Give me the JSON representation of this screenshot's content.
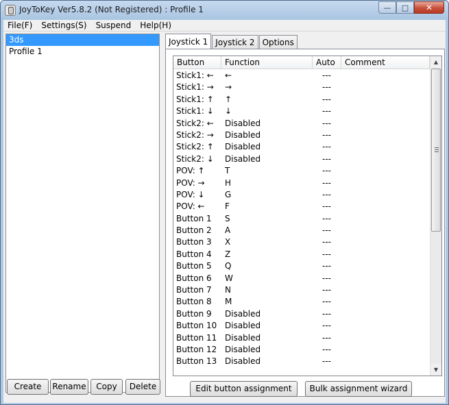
{
  "window": {
    "title": "JoyToKey Ver5.8.2 (Not Registered) : Profile 1",
    "buttons": {
      "minimize": "—",
      "maximize": "□",
      "close": "✕"
    }
  },
  "menu": [
    "File(F)",
    "Settings(S)",
    "Suspend",
    "Help(H)"
  ],
  "profiles": {
    "items": [
      {
        "label": "3ds",
        "selected": true
      },
      {
        "label": "Profile 1",
        "selected": false
      }
    ],
    "buttons": {
      "create": "Create",
      "rename": "Rename",
      "copy": "Copy",
      "delete": "Delete"
    }
  },
  "tabs": [
    {
      "label": "Joystick 1",
      "active": true
    },
    {
      "label": "Joystick 2",
      "active": false
    },
    {
      "label": "Options",
      "active": false
    }
  ],
  "table": {
    "columns": [
      "Button",
      "Function",
      "Auto",
      "Comment"
    ],
    "rows": [
      [
        "Stick1: ←",
        "←",
        "---",
        ""
      ],
      [
        "Stick1: →",
        "→",
        "---",
        ""
      ],
      [
        "Stick1: ↑",
        "↑",
        "---",
        ""
      ],
      [
        "Stick1: ↓",
        "↓",
        "---",
        ""
      ],
      [
        "Stick2: ←",
        "Disabled",
        "---",
        ""
      ],
      [
        "Stick2: →",
        "Disabled",
        "---",
        ""
      ],
      [
        "Stick2: ↑",
        "Disabled",
        "---",
        ""
      ],
      [
        "Stick2: ↓",
        "Disabled",
        "---",
        ""
      ],
      [
        "POV: ↑",
        "T",
        "---",
        ""
      ],
      [
        "POV: →",
        "H",
        "---",
        ""
      ],
      [
        "POV: ↓",
        "G",
        "---",
        ""
      ],
      [
        "POV: ←",
        "F",
        "---",
        ""
      ],
      [
        "Button 1",
        "S",
        "---",
        ""
      ],
      [
        "Button 2",
        "A",
        "---",
        ""
      ],
      [
        "Button 3",
        "X",
        "---",
        ""
      ],
      [
        "Button 4",
        "Z",
        "---",
        ""
      ],
      [
        "Button 5",
        "Q",
        "---",
        ""
      ],
      [
        "Button 6",
        "W",
        "---",
        ""
      ],
      [
        "Button 7",
        "N",
        "---",
        ""
      ],
      [
        "Button 8",
        "M",
        "---",
        ""
      ],
      [
        "Button 9",
        "Disabled",
        "---",
        ""
      ],
      [
        "Button 10",
        "Disabled",
        "---",
        ""
      ],
      [
        "Button 11",
        "Disabled",
        "---",
        ""
      ],
      [
        "Button 12",
        "Disabled",
        "---",
        ""
      ],
      [
        "Button 13",
        "Disabled",
        "---",
        ""
      ]
    ]
  },
  "actions": {
    "edit": "Edit button assignment",
    "wizard": "Bulk assignment wizard"
  },
  "scrollbar": {
    "up": "▲",
    "down": "▼"
  },
  "colors": {
    "selection": "#3399ff",
    "titlebar": "#aec8e3"
  }
}
